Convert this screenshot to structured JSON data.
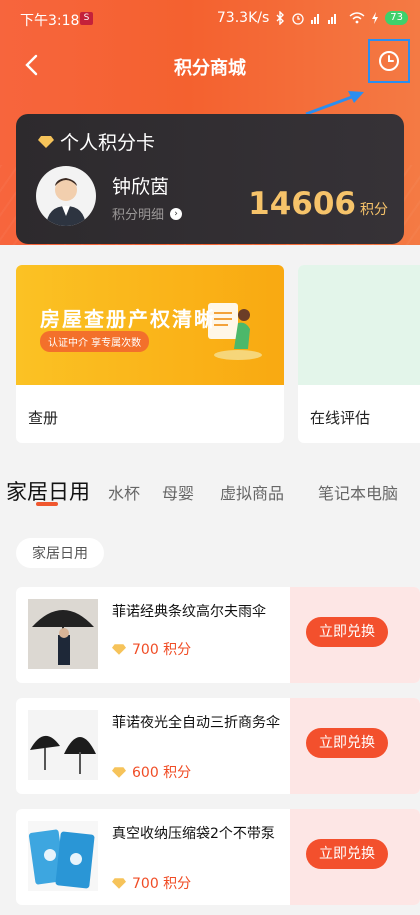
{
  "status_bar": {
    "time": "下午3:18",
    "network_speed": "73.3K/s",
    "battery": "73"
  },
  "nav": {
    "title": "积分商城"
  },
  "card": {
    "label": "个人积分卡",
    "user_name": "钟欣茵",
    "detail_link": "积分明细",
    "points": "14606",
    "points_unit": "积分"
  },
  "banners": [
    {
      "image_title": "房屋查册产权清晰",
      "image_tag": "认证中介 享专属次数",
      "caption": "查册"
    },
    {
      "caption": "在线评估"
    }
  ],
  "tabs": [
    "家居日用",
    "水杯",
    "母婴",
    "虚拟商品",
    "笔记本电脑"
  ],
  "section": "家居日用",
  "items": [
    {
      "name": "菲诺经典条纹高尔夫雨伞",
      "price": "700 积分",
      "button": "立即兑换"
    },
    {
      "name": "菲诺夜光全自动三折商务伞",
      "price": "600 积分",
      "button": "立即兑换"
    },
    {
      "name": "真空收纳压缩袋2个不带泵",
      "price": "700 积分",
      "button": "立即兑换"
    }
  ],
  "colors": {
    "accent": "#f3502d",
    "header": "#f4612f",
    "points_gold": "#f6c36a"
  }
}
